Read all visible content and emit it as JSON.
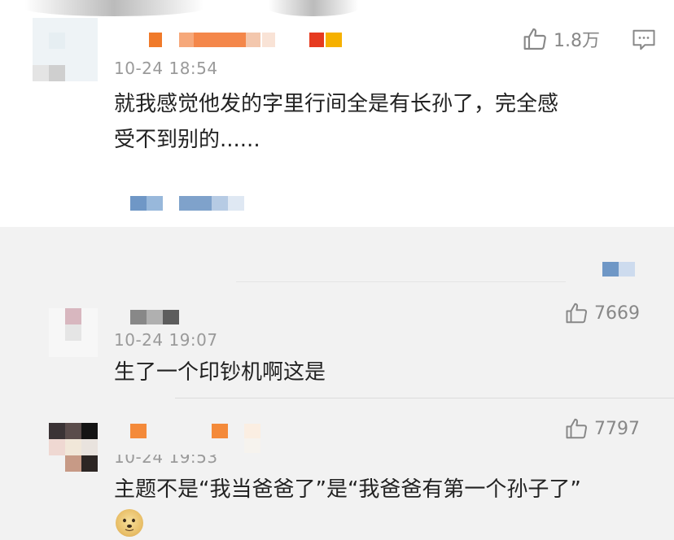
{
  "comments": [
    {
      "time": "10-24 18:54",
      "text_line1": "就我感觉他发的字里行间全是有长孙了，完全感",
      "text_line2": "受不到别的......",
      "likes": "1.8万"
    },
    {
      "time": "10-24 19:07",
      "text": "生了一个印钞机啊这是",
      "likes": "7669"
    },
    {
      "time": "10-24 19:53",
      "text": "主题不是“我当爸爸了”是“我爸爸有第一个孙子了”",
      "likes": "7797"
    }
  ],
  "icons": {
    "like": "thumbs-up-icon",
    "reply": "comment-icon",
    "emoji": "doge-emoji-icon"
  },
  "colors": {
    "top_card_bg": "#ffffff",
    "page_bg": "#f2f2f2",
    "text": "#222222",
    "meta": "#9a9a9a",
    "link_blur": "#6f97c6",
    "name_blur": "#f07a2a"
  }
}
